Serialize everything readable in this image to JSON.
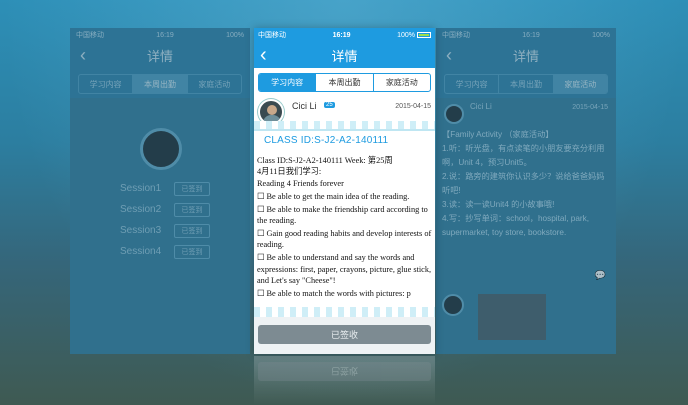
{
  "status": {
    "carrier": "中国移动",
    "time": "16:19",
    "battery": "100%"
  },
  "nav": {
    "title": "详情"
  },
  "tabs": [
    {
      "label": "学习内容",
      "active": true
    },
    {
      "label": "本周出勤",
      "active": false
    },
    {
      "label": "家庭活动",
      "active": false
    }
  ],
  "post": {
    "name": "Cici Li",
    "badge": "25",
    "date": "2015-04-15",
    "class_id_heading": "CLASS ID:S-J2-A2-140111",
    "lines": [
      "Class ID:S-J2-A2-140111 Week: 第25周",
      "4月11日我们学习:",
      "Reading 4 Friends forever"
    ],
    "checklist": [
      "☐ Be able to get the main idea of the reading.",
      "☐ Be able to make the friendship card according to the reading.",
      "☐ Gain good reading habits and develop interests of reading.",
      "☐ Be able to understand and say the words and expressions: first, paper, crayons, picture, glue stick, and Let's say \"Cheese\"!",
      "☐ Be able to match the words with pictures: p"
    ]
  },
  "sign_button": {
    "label": "已签收"
  },
  "left_screen": {
    "title": "详情",
    "tabs": [
      "学习内容",
      "本周出勤",
      "家庭活动"
    ],
    "sessions": [
      {
        "label": "Session1",
        "status": "已签到"
      },
      {
        "label": "Session2",
        "status": "已签到"
      },
      {
        "label": "Session3",
        "status": "已签到"
      },
      {
        "label": "Session4",
        "status": "已签到"
      }
    ]
  },
  "right_screen": {
    "title": "详情",
    "tabs": [
      "学习内容",
      "本周出勤",
      "家庭活动"
    ],
    "name": "Cici Li",
    "date": "2015-04-15",
    "activity_lines": [
      "【Family Activity （家庭活动】",
      "1.听：听光盘，有点读笔的小朋友要充分利用啊，Unit 4，预习Unit5。",
      "2.说：路旁的建筑你认识多少？说给爸爸妈妈听吧!",
      "3.读：读一读Unit4 的小故事哦!",
      "4.写：抄写单词：school，hospital, park, supermarket, toy store, bookstore."
    ]
  }
}
